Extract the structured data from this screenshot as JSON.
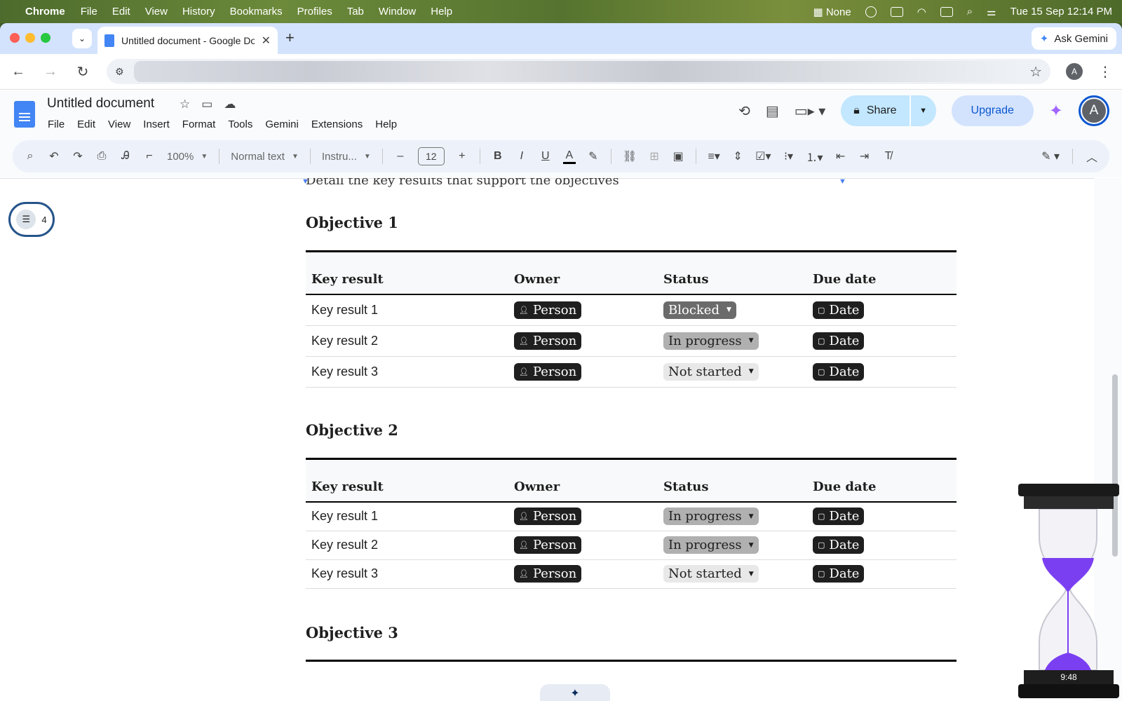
{
  "menubar": {
    "app": "Chrome",
    "items": [
      "File",
      "Edit",
      "View",
      "History",
      "Bookmarks",
      "Profiles",
      "Tab",
      "Window",
      "Help"
    ],
    "focus": "None",
    "datetime": "Tue 15 Sep  12:14 PM"
  },
  "browser": {
    "tab_title": "Untitled document - Google Docs",
    "ask_gemini": "Ask Gemini",
    "profile_initial": "A"
  },
  "docs": {
    "title": "Untitled document",
    "menu": [
      "File",
      "Edit",
      "View",
      "Insert",
      "Format",
      "Tools",
      "Gemini",
      "Extensions",
      "Help"
    ],
    "share_label": "Share",
    "upgrade_label": "Upgrade",
    "avatar_initial": "A"
  },
  "toolbar": {
    "zoom": "100%",
    "style": "Normal text",
    "font": "Instru...",
    "font_size": "12"
  },
  "outline": {
    "count": "4"
  },
  "document": {
    "intro": "Detail the key results that support the objectives",
    "headers": [
      "Key result",
      "Owner",
      "Status",
      "Due date"
    ],
    "objectives": [
      {
        "title": "Objective 1",
        "rows": [
          {
            "kr": "Key result 1",
            "owner": "Person",
            "status": "Blocked",
            "status_kind": "blocked",
            "due": "Date"
          },
          {
            "kr": "Key result 2",
            "owner": "Person",
            "status": "In progress",
            "status_kind": "inprog",
            "due": "Date"
          },
          {
            "kr": "Key result 3",
            "owner": "Person",
            "status": "Not started",
            "status_kind": "notstart",
            "due": "Date"
          }
        ]
      },
      {
        "title": "Objective 2",
        "rows": [
          {
            "kr": "Key result 1",
            "owner": "Person",
            "status": "In progress",
            "status_kind": "inprog",
            "due": "Date"
          },
          {
            "kr": "Key result 2",
            "owner": "Person",
            "status": "In progress",
            "status_kind": "inprog",
            "due": "Date"
          },
          {
            "kr": "Key result 3",
            "owner": "Person",
            "status": "Not started",
            "status_kind": "notstart",
            "due": "Date"
          }
        ]
      },
      {
        "title": "Objective 3"
      }
    ]
  },
  "timer": {
    "time": "9:48"
  },
  "colors": {
    "accent": "#0b57d0",
    "share_bg": "#c2e7ff",
    "toolbar_bg": "#edf2fa",
    "hourglass_sand": "#7b3ff2"
  }
}
